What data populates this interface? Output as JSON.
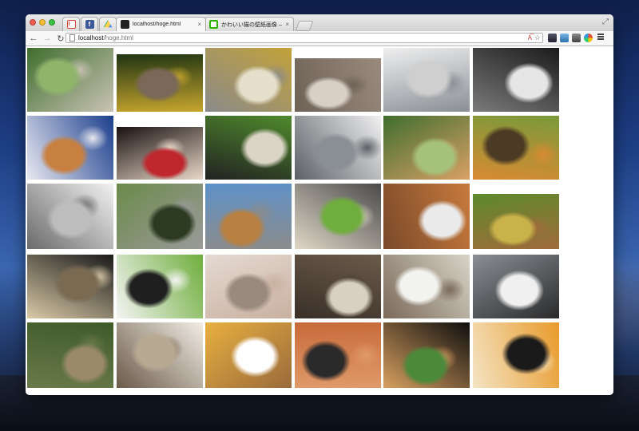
{
  "browser": {
    "tabs": [
      {
        "id": "gmail",
        "title": "",
        "favicon": "gmail-icon",
        "pinned": true
      },
      {
        "id": "facebook",
        "title": "",
        "favicon": "facebook-icon",
        "pinned": true
      },
      {
        "id": "drive",
        "title": "",
        "favicon": "google-drive-icon",
        "pinned": true
      },
      {
        "id": "hoge",
        "title": "localhost/hoge.html",
        "favicon": "page-icon",
        "pinned": false,
        "active": true
      },
      {
        "id": "naver",
        "title": "かわいい猫の壁紙画像 – NAVER",
        "favicon": "naver-icon",
        "pinned": false
      }
    ],
    "close_glyph": "×",
    "url_host": "localhost",
    "url_path": "/hoge.html",
    "back_glyph": "←",
    "forward_glyph": "→",
    "reload_glyph": "↻",
    "translate_glyph": "A͡",
    "star_glyph": "☆",
    "fullscreen_glyph": "⤢"
  },
  "extensions": [
    "extension-icon-1",
    "extension-icon-2",
    "extension-icon-3",
    "extension-icon-4"
  ],
  "gallery": {
    "photos": [
      {
        "subject": "calico kitten in garden",
        "colors": [
          "#3f6e2e",
          "#8fb46a",
          "#c9c3b4"
        ]
      },
      {
        "subject": "three kittens among flowers",
        "colors": [
          "#1f3412",
          "#7a6858",
          "#c7a62e"
        ]
      },
      {
        "subject": "kitten in metal bucket",
        "colors": [
          "#c3a23a",
          "#e6dfcc",
          "#8a8a8a"
        ]
      },
      {
        "subject": "sleeping kittens pile",
        "colors": [
          "#9a8a7e",
          "#d8cfc5",
          "#6e6256"
        ]
      },
      {
        "subject": "kitten in kitchen sink",
        "colors": [
          "#efefef",
          "#cfcfcf",
          "#8a8f95"
        ]
      },
      {
        "subject": "white cat lying",
        "colors": [
          "#1c1c1c",
          "#e6e6e6",
          "#7a7a7a"
        ]
      },
      {
        "subject": "orange cat with bow",
        "colors": [
          "#1c3f8e",
          "#c88040",
          "#e8e8f0"
        ]
      },
      {
        "subject": "siamese kitten in red flowers",
        "colors": [
          "#1a1010",
          "#c0262d",
          "#e7d8c8"
        ]
      },
      {
        "subject": "two kittens on grass",
        "colors": [
          "#4f8a2c",
          "#d9d4c4",
          "#222222"
        ]
      },
      {
        "subject": "grey fluffy cat",
        "colors": [
          "#f0f0f0",
          "#8a8f95",
          "#5c6066"
        ]
      },
      {
        "subject": "orange kitten on grass",
        "colors": [
          "#3f6e2e",
          "#a6c27a",
          "#d9a066"
        ]
      },
      {
        "subject": "orange kitten climbing tree",
        "colors": [
          "#7a9a3a",
          "#4b3a24",
          "#d88a32"
        ]
      },
      {
        "subject": "grey white cat with blue eyes",
        "colors": [
          "#f2f2f2",
          "#bdbdbd",
          "#6a6a6a"
        ]
      },
      {
        "subject": "tabby kitten walking",
        "colors": [
          "#6c8a4a",
          "#2c3a22",
          "#9a9a9a"
        ]
      },
      {
        "subject": "kitten with teddy bear",
        "colors": [
          "#5e91c8",
          "#b88040",
          "#8c8c8c"
        ]
      },
      {
        "subject": "calico kitten on porch",
        "colors": [
          "#4a4a4a",
          "#6fae3c",
          "#e0d8c8"
        ]
      },
      {
        "subject": "orange kitten lying",
        "colors": [
          "#c87a3c",
          "#eaeaea",
          "#7a4a2a"
        ]
      },
      {
        "subject": "kitten in meadow",
        "colors": [
          "#5d8a2c",
          "#c9b24a",
          "#a06a3a"
        ]
      },
      {
        "subject": "tabby cat in dark",
        "colors": [
          "#1a1a1a",
          "#7a6a52",
          "#d9c9a6"
        ]
      },
      {
        "subject": "black white kitten",
        "colors": [
          "#6fae3c",
          "#1f1f1f",
          "#f4f4f4"
        ]
      },
      {
        "subject": "kitten on back",
        "colors": [
          "#e4dad2",
          "#9a8a7e",
          "#c9b0a0"
        ]
      },
      {
        "subject": "kitten at window",
        "colors": [
          "#6a5a4a",
          "#d8d0c0",
          "#3a3028"
        ]
      },
      {
        "subject": "meowing kitten",
        "colors": [
          "#d8d4c8",
          "#f2f2ee",
          "#7a6a5a"
        ]
      },
      {
        "subject": "white cat closeup",
        "colors": [
          "#8a8f95",
          "#f0f0f0",
          "#2a2a2a"
        ]
      },
      {
        "subject": "tabby kitten in grass",
        "colors": [
          "#3f5a2a",
          "#9a8a6a",
          "#6a7a4a"
        ]
      },
      {
        "subject": "kittens on white blanket",
        "colors": [
          "#f2ede4",
          "#b8aa92",
          "#6a5a4a"
        ]
      },
      {
        "subject": "kitten with fishbowl",
        "colors": [
          "#e8b040",
          "#ffffff",
          "#9a6a3a"
        ]
      },
      {
        "subject": "black kitten on wood",
        "colors": [
          "#c86a3a",
          "#2a2a2a",
          "#e09a6a"
        ]
      },
      {
        "subject": "kitten near palm",
        "colors": [
          "#0e0e0e",
          "#4a8a3a",
          "#d8a060"
        ]
      },
      {
        "subject": "calico kitten lying",
        "colors": [
          "#e89a2a",
          "#1a1a1a",
          "#f4e4c4"
        ]
      }
    ]
  }
}
